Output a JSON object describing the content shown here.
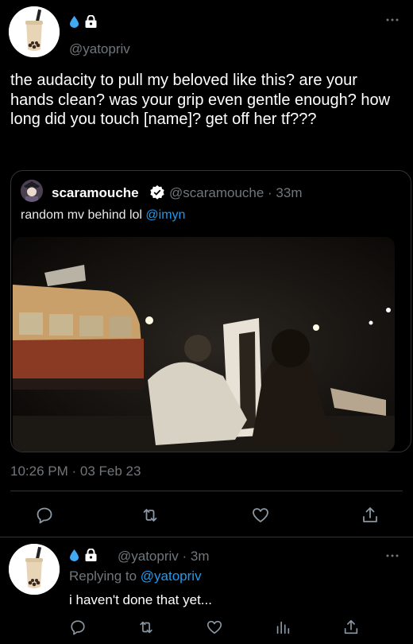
{
  "main_tweet": {
    "handle": "@yatopriv",
    "text": "the audacity to pull my beloved like this? are your hands clean? was your grip even gentle enough? how long did you touch [name]? get off her tf???",
    "timestamp": "10:26 PM · 03 Feb 23"
  },
  "quote": {
    "name": "scaramouche",
    "handle": "@scaramouche",
    "separator": " · ",
    "time": "33m",
    "text": "random mv behind lol ",
    "mention": "@imyn"
  },
  "reply": {
    "handle_time": "@yatopriv · 3m",
    "replying_prefix": "Replying to ",
    "replying_handle": "@yatopriv",
    "text": "i haven't done that yet..."
  },
  "icons": {
    "actions": [
      "reply-icon",
      "retweet-icon",
      "like-icon",
      "share-icon"
    ],
    "reply_actions": [
      "reply-icon",
      "retweet-icon",
      "like-icon",
      "analytics-icon",
      "share-icon"
    ]
  },
  "colors": {
    "accent": "#1d9bf0",
    "muted": "#71767b",
    "background": "#000000"
  }
}
